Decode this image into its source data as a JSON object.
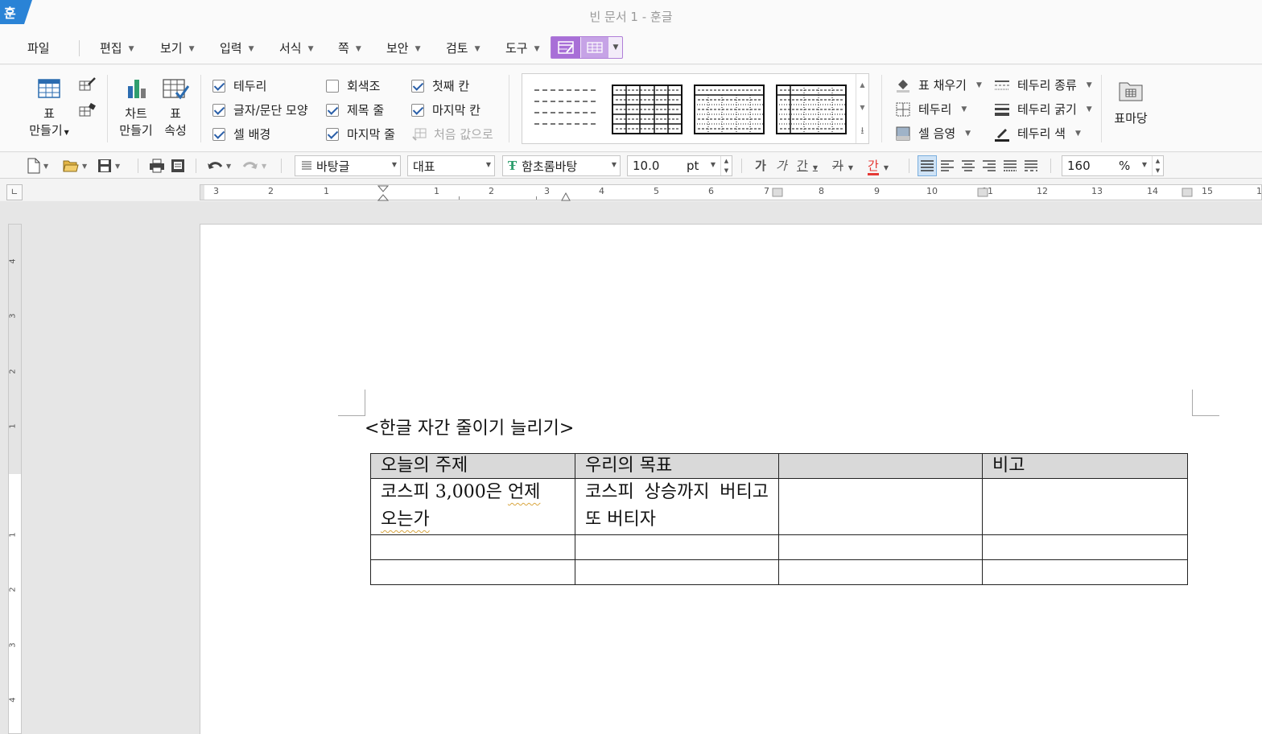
{
  "window": {
    "title": "빈 문서 1 - 훈글",
    "logo_char": "훈"
  },
  "menu": {
    "file": "파일",
    "items": [
      "편집",
      "보기",
      "입력",
      "서식",
      "쪽",
      "보안",
      "검토",
      "도구"
    ]
  },
  "ribbon": {
    "make_table": {
      "line1": "표",
      "line2": "만들기"
    },
    "make_chart": {
      "line1": "차트",
      "line2": "만들기"
    },
    "table_props": {
      "line1": "표",
      "line2": "속성"
    },
    "checks_col1": [
      {
        "label": "테두리",
        "checked": true
      },
      {
        "label": "글자/문단 모양",
        "checked": true
      },
      {
        "label": "셀 배경",
        "checked": true
      }
    ],
    "checks_col2": [
      {
        "label": "회색조",
        "checked": false
      },
      {
        "label": "제목 줄",
        "checked": true
      },
      {
        "label": "마지막 줄",
        "checked": true
      }
    ],
    "checks_col3": [
      {
        "label": "첫째 칸",
        "checked": true
      },
      {
        "label": "마지막 칸",
        "checked": true
      }
    ],
    "reset_label": "처음 값으로",
    "fill_label": "표 채우기",
    "border_label": "테두리",
    "shade_label": "셀 음영",
    "border_type_label": "테두리 종류",
    "border_width_label": "테두리 굵기",
    "border_color_label": "테두리 색",
    "table_yard_label": "표마당"
  },
  "toolbar": {
    "style": "바탕글",
    "lang": "대표",
    "font": "함초롬바탕",
    "size": "10.0",
    "size_unit": "pt",
    "zoom": "160",
    "zoom_unit": "%",
    "bold": "가",
    "italic": "가",
    "underline": "간",
    "strike": "가",
    "color_char": "간",
    "text_color": "#e53935"
  },
  "ruler": {
    "h_labels": [
      "3",
      "2",
      "1",
      "1",
      "2",
      "3",
      "4",
      "5",
      "6",
      "7",
      "8",
      "9",
      "10",
      "11",
      "12",
      "13",
      "14",
      "15",
      "1"
    ],
    "v_labels": [
      "4",
      "3",
      "2",
      "1",
      "1",
      "2",
      "3",
      "4"
    ],
    "corner": "∟"
  },
  "document": {
    "heading": "<한글 자간 줄이기 늘리기>",
    "table": {
      "header": [
        "오늘의 주제",
        "우리의 목표",
        "",
        "비고"
      ],
      "row1": {
        "c1_a": "코스피 3,000은 ",
        "c1_b": "언제",
        "c1_c": "오는가",
        "c2": "코스피 상승까지 버티고 또 버티자",
        "c3": "",
        "c4": ""
      }
    }
  }
}
